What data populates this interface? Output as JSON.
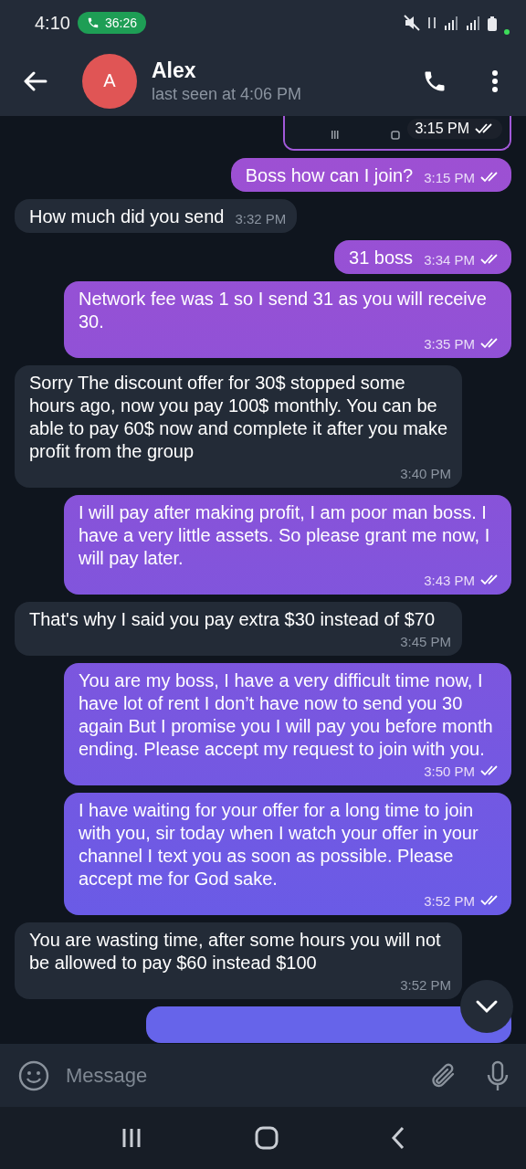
{
  "status_bar": {
    "time": "4:10",
    "call_timer": "36:26"
  },
  "header": {
    "name": "Alex",
    "avatar_letter": "A",
    "status": "last seen at 4:06 PM"
  },
  "messages": [
    {
      "outgoing": true,
      "time": "3:15 PM",
      "read": true
    },
    {
      "outgoing": true,
      "kind": "text",
      "text": "Boss how can I join?",
      "time": "3:15 PM",
      "read": true
    },
    {
      "outgoing": false,
      "kind": "text",
      "text": "How much did you send",
      "time": "3:32 PM"
    },
    {
      "outgoing": true,
      "kind": "text",
      "text": "31 boss",
      "time": "3:34 PM",
      "read": true
    },
    {
      "outgoing": true,
      "kind": "text",
      "text": "Network fee was 1 so I send 31 as you will receive 30.",
      "time": "3:35 PM",
      "read": true
    },
    {
      "outgoing": false,
      "kind": "text",
      "text": "Sorry The discount offer for 30$ stopped some hours ago, now you pay 100$ monthly. You can be able to pay 60$ now and complete it after you make profit from the group",
      "time": "3:40 PM"
    },
    {
      "outgoing": true,
      "kind": "text",
      "text": "I will pay after making profit, I am poor man boss. I have a very little assets. So please grant me now, I will pay later.",
      "time": "3:43 PM",
      "read": true
    },
    {
      "outgoing": false,
      "kind": "text",
      "text": "That's why I said you pay extra $30 instead of $70",
      "time": "3:45 PM"
    },
    {
      "outgoing": true,
      "kind": "text",
      "text": "You are my boss, I have a very difficult time now, I have lot of rent I don’t have now to send you 30 again But I promise you I will pay you before month ending. Please accept my request to join with you.",
      "time": "3:50 PM",
      "read": true
    },
    {
      "outgoing": true,
      "kind": "text",
      "text": "I have waiting for your offer for a long time to join with you, sir today when I watch your offer in your channel I text you as soon as possible. Please accept me for God sake.",
      "time": "3:52 PM",
      "read": true
    },
    {
      "outgoing": false,
      "kind": "text",
      "text": "You are wasting time, after some hours you will not be allowed to pay $60 instead $100",
      "time": "3:52 PM"
    },
    {
      "outgoing": true,
      "kind": "clipped"
    }
  ],
  "composer": {
    "placeholder": "Message"
  }
}
